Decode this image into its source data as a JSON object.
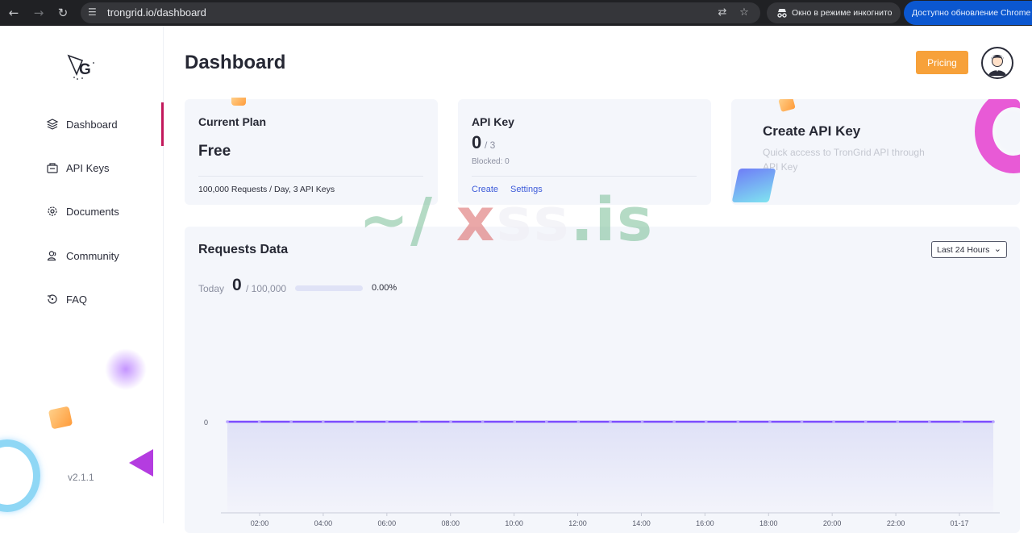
{
  "browser": {
    "url": "trongrid.io/dashboard",
    "incognito_label": "Окно в режиме инкогнито",
    "update_label": "Доступно обновление Chrome"
  },
  "sidebar": {
    "items": [
      {
        "label": "Dashboard",
        "icon": "layers-icon",
        "active": true
      },
      {
        "label": "API Keys",
        "icon": "key-card-icon",
        "active": false
      },
      {
        "label": "Documents",
        "icon": "gear-doc-icon",
        "active": false
      },
      {
        "label": "Community",
        "icon": "people-icon",
        "active": false
      },
      {
        "label": "FAQ",
        "icon": "faq-icon",
        "active": false
      }
    ],
    "version": "v2.1.1"
  },
  "header": {
    "title": "Dashboard",
    "pricing_label": "Pricing"
  },
  "current_plan": {
    "title": "Current Plan",
    "value": "Free",
    "footer": "100,000 Requests / Day, 3 API Keys"
  },
  "api_key": {
    "title": "API Key",
    "count": "0",
    "total": "/ 3",
    "blocked": "Blocked: 0",
    "create_label": "Create",
    "settings_label": "Settings"
  },
  "create_api_key": {
    "title": "Create API Key",
    "description": "Quick access to TronGrid API through API Key"
  },
  "requests": {
    "title": "Requests Data",
    "range": "Last 24 Hours",
    "today_label": "Today",
    "today_value": "0",
    "today_total": "/ 100,000",
    "progress_fraction": 0,
    "percent": "0.00%"
  },
  "watermark": {
    "a": "~/ ",
    "b": "x",
    "c": "ss",
    "d": ".is"
  },
  "colors": {
    "accent": "#7c4dff",
    "active_bar": "#c2185b",
    "pricing": "#f7a13a",
    "link": "#3d5bd9"
  },
  "chart_data": {
    "type": "line",
    "y_tick_labels": [
      "0"
    ],
    "x_tick_labels": [
      "02:00",
      "04:00",
      "06:00",
      "08:00",
      "10:00",
      "12:00",
      "14:00",
      "16:00",
      "18:00",
      "20:00",
      "22:00",
      "01-17"
    ],
    "series": [
      {
        "values": [
          0,
          0,
          0,
          0,
          0,
          0,
          0,
          0,
          0,
          0,
          0,
          0,
          0,
          0,
          0,
          0,
          0,
          0,
          0,
          0,
          0,
          0,
          0,
          0,
          0
        ]
      }
    ]
  }
}
